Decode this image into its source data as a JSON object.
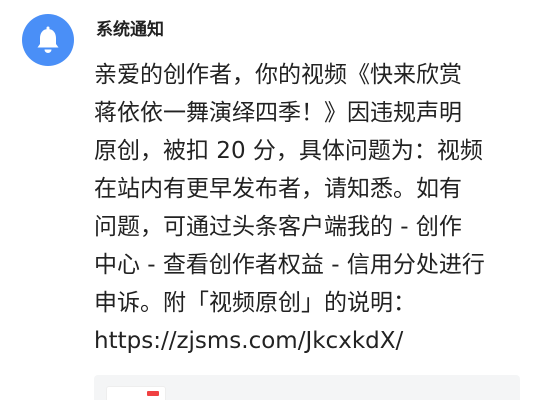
{
  "notification": {
    "sender": "系统通知",
    "icon": "bell-icon",
    "accent_color": "#4a8ff7",
    "message_lines": [
      "亲爱的创作者，你的视频《快来欣赏",
      "蒋依依一舞演绎四季！》因违规声明",
      "原创，被扣 20 分，具体问题为：视频",
      "在站内有更早发布者，请知悉。如有",
      "问题，可通过头条客户端我的 - 创作",
      "中心 - 查看创作者权益 - 信用分处进行",
      "申诉。附「视频原创」的说明：",
      "https://zjsms.com/JkcxkdX/"
    ]
  }
}
